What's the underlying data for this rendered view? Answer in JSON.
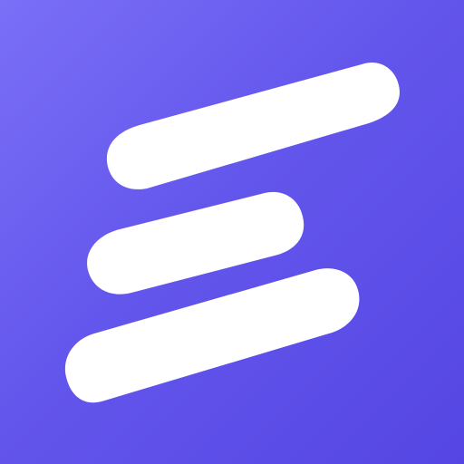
{
  "icon": {
    "name": "stylized-e-logo-icon",
    "background_colors": [
      "#7a6ff7",
      "#6356ec",
      "#5546e3"
    ],
    "mark_color": "#ffffff"
  }
}
